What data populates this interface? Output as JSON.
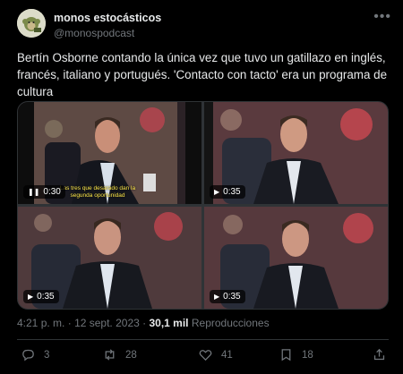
{
  "author": {
    "display_name": "monos estocásticos",
    "handle": "@monospodcast",
    "avatar_icon": "monkey-avatar-icon"
  },
  "more_icon": "more-icon",
  "tweet": {
    "text": "Bertín Osborne contando la única vez que tuvo un gatillazo en inglés, francés, italiano y portugués. 'Contacto con tacto' era un programa de cultura"
  },
  "videos": [
    {
      "time": "0:30",
      "state": "playing",
      "subtitle": "Las tres que desarado dan la segunda oportunidad"
    },
    {
      "time": "0:35",
      "state": "paused"
    },
    {
      "time": "0:35",
      "state": "paused"
    },
    {
      "time": "0:35",
      "state": "paused"
    }
  ],
  "meta": {
    "time": "4:21 p. m.",
    "separator1": "·",
    "date": "12 sept. 2023",
    "separator2": "·",
    "views_count": "30,1 mil",
    "views_label": "Reproducciones"
  },
  "actions": {
    "replies": "3",
    "retweets": "28",
    "likes": "41",
    "bookmarks": "18"
  },
  "colors": {
    "background": "#000000",
    "text": "#e7e9ea",
    "muted": "#71767b",
    "border": "#2f3336",
    "subtitle": "#ffe94a"
  }
}
